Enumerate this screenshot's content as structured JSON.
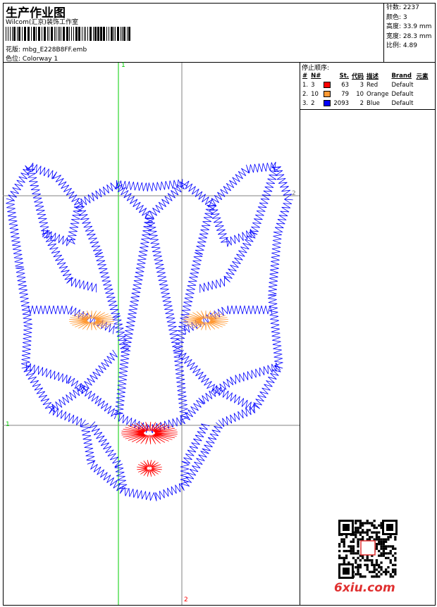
{
  "header": {
    "title": "生产作业图",
    "company": "Wilcom(汇京)装饰工作室",
    "design_label": "花版:",
    "design_file": "mbg_E228B8FF.emb",
    "colorway_label": "色位:",
    "colorway": "Colorway 1"
  },
  "info": [
    {
      "label": "针数:",
      "value": "2237"
    },
    {
      "label": "颜色:",
      "value": "3"
    },
    {
      "label": "高度:",
      "value": "33.9 mm"
    },
    {
      "label": "宽度:",
      "value": "28.3 mm"
    },
    {
      "label": "比例:",
      "value": "4.89"
    }
  ],
  "stop_sequence": {
    "title": "停止顺序:",
    "columns": [
      "#",
      "N#",
      "St.",
      "代码",
      "描述",
      "Brand",
      "元素"
    ],
    "rows": [
      {
        "idx": "1.",
        "n": "3",
        "color": "#ff0000",
        "st": "63",
        "code": "3",
        "desc": "Red",
        "brand": "Default"
      },
      {
        "idx": "2.",
        "n": "10",
        "color": "#ff9933",
        "st": "79",
        "code": "10",
        "desc": "Orange",
        "brand": "Default"
      },
      {
        "idx": "3.",
        "n": "2",
        "color": "#0000ff",
        "st": "2093",
        "code": "2",
        "desc": "Blue",
        "brand": "Default"
      }
    ]
  },
  "guides": {
    "v1": "1",
    "v2": "2",
    "h1": "1",
    "h2": "2"
  },
  "colors": {
    "blue": "#0000ff",
    "red": "#ff0000",
    "orange": "#ff9933",
    "guide_green": "#00cc00",
    "guide_gray": "#808080"
  },
  "watermark": "6xiu.com"
}
